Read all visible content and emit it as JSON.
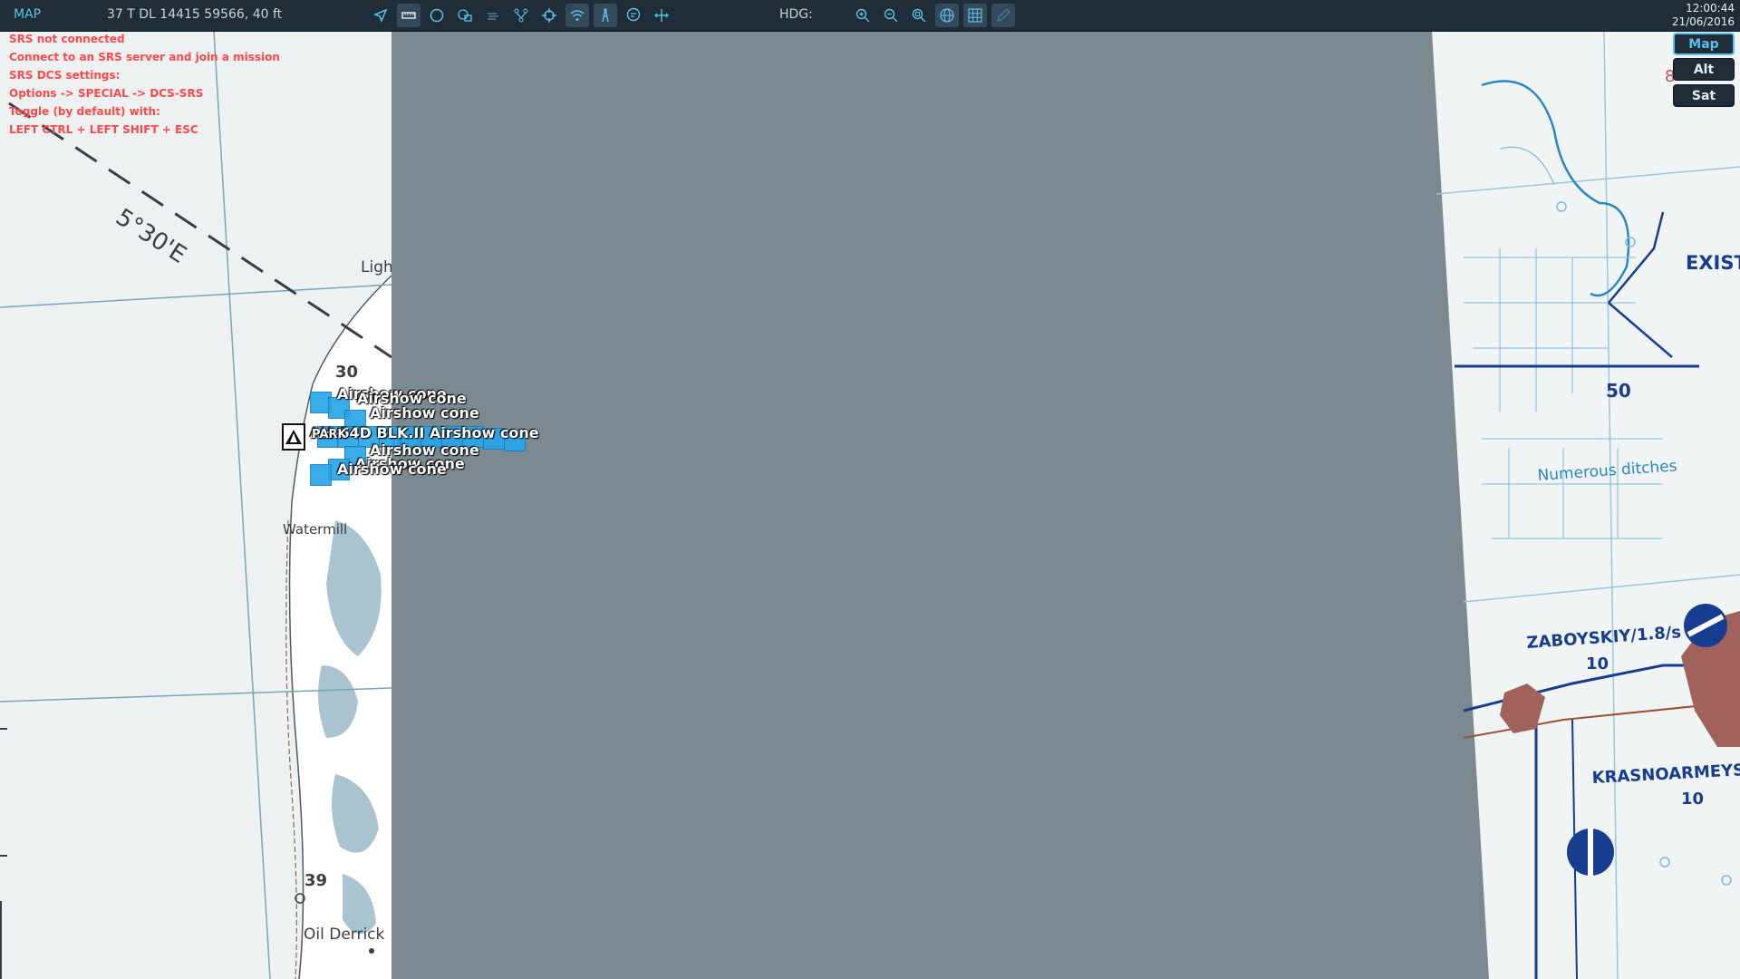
{
  "toolbar": {
    "mode": "MAP",
    "coords": "37 T DL 14415 59566, 40 ft",
    "hdg_label": "HDG:",
    "time": "12:00:44",
    "date": "21/06/2016",
    "icons_left": [
      "navigate-icon",
      "ruler-icon",
      "circle-icon",
      "chat-stack-icon",
      "weather-icon",
      "branch-icon",
      "crosshair-icon",
      "wifi-icon",
      "tower-icon",
      "message-icon",
      "move-icon"
    ],
    "icons_right": [
      "zoom-in-icon",
      "zoom-out-icon",
      "zoom-fit-icon",
      "globe-icon",
      "grid-icon",
      "pencil-icon"
    ]
  },
  "srs": {
    "line1": "SRS not connected",
    "line2": "Connect to an SRS server and join a mission",
    "line3": "SRS DCS settings:",
    "line4": "Options -> SPECIAL -> DCS-SRS",
    "line5": "Toggle (by default) with:",
    "line6": "LEFT CTRL + LEFT SHIFT + ESC"
  },
  "layers": {
    "map": "Map",
    "alt": "Alt",
    "sat": "Sat"
  },
  "units": {
    "cone1": "Airshow cone",
    "cone2": "Airshow cone",
    "cone3": "Airshow cone",
    "center": "AH-64D BLK.II Airshow cone",
    "cone4": "Airshow cone",
    "cone5": "Airshow cone",
    "cone6": "Airshow cone",
    "airfield_label": "PARK"
  },
  "map_labels": {
    "meridian": "5°30'E",
    "light": "Ligh",
    "n30": "30",
    "watermill": "Watermill",
    "n39": "39",
    "oil": "Oil Derrick",
    "existe": "EXISTE",
    "n50": "50",
    "ditches": "Numerous ditches",
    "zaboyskiy": "ZABOYSKIY/1.8/s",
    "n10a": "10",
    "krasno": "KRASNOARMEYSK",
    "n10b": "10",
    "n8": "8"
  },
  "colors": {
    "accent": "#5cc1e8",
    "toolbar_bg": "#1f2d39",
    "srs_warning": "#ff4a4a",
    "unit_blue": "#29a6e8",
    "map_gap": "#7b8a91"
  }
}
